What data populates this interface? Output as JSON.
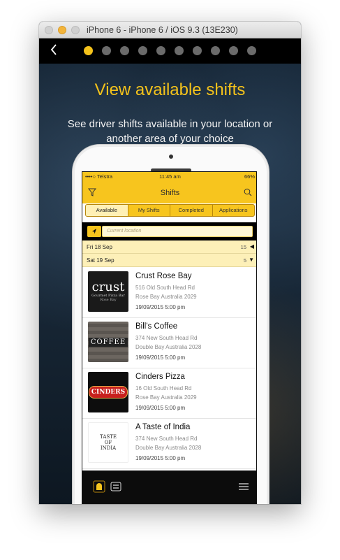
{
  "window": {
    "title": "iPhone 6 - iPhone 6 / iOS 9.3 (13E230)"
  },
  "onboarding": {
    "back_icon": "chevron-left-icon",
    "page_count": 10,
    "active_page": 1,
    "headline": "View available shifts",
    "subtext": "See driver shifts available in your location or another area of your choice"
  },
  "app": {
    "status": {
      "carrier": "••••○ Telstra",
      "time": "11:45 am",
      "battery": "66%"
    },
    "nav": {
      "title": "Shifts",
      "left_icon": "filter-icon",
      "right_icon": "search-icon"
    },
    "tabs": [
      "Available",
      "My Shifts",
      "Completed",
      "Applications"
    ],
    "active_tab": "Available",
    "location": {
      "placeholder": "Current location",
      "icon": "location-arrow-icon"
    },
    "days": [
      {
        "label": "Fri 18 Sep",
        "count": "15",
        "state": "collapsed"
      },
      {
        "label": "Sat 19 Sep",
        "count": "5",
        "state": "expanded"
      }
    ],
    "shifts": [
      {
        "name": "Crust Rose Bay",
        "address": "516 Old South Head Rd",
        "suburb": "Rose Bay Australia 2029",
        "datetime": "19/09/2015 5:00 pm",
        "logo": "crust",
        "logo_line1": "crust",
        "logo_line2": "Gourmet Pizza Bar",
        "logo_line3": "Rose Bay"
      },
      {
        "name": "Bill's Coffee",
        "address": "374 New South Head Rd",
        "suburb": "Double Bay Australia 2028",
        "datetime": "19/09/2015 5:00 pm",
        "logo": "coffee",
        "logo_line1": "COFFEE"
      },
      {
        "name": "Cinders Pizza",
        "address": "16 Old South Head Rd",
        "suburb": "Rose Bay Australia 2029",
        "datetime": "19/09/2015 5:00 pm",
        "logo": "cinders",
        "logo_line1": "CINDERS"
      },
      {
        "name": "A Taste of India",
        "address": "374 New South Head Rd",
        "suburb": "Double Bay Australia 2028",
        "datetime": "19/09/2015 5:00 pm",
        "logo": "india",
        "logo_line1": "TASTE",
        "logo_line2": "OF",
        "logo_line3": "INDIA"
      }
    ],
    "bottom_bar": {
      "icons": [
        "chef-hat-icon",
        "sync-icon",
        "hamburger-menu-icon"
      ]
    }
  },
  "colors": {
    "accent": "#f4c21b",
    "app_yellow": "#f7c51e",
    "row_cream": "#fdf0b8"
  }
}
